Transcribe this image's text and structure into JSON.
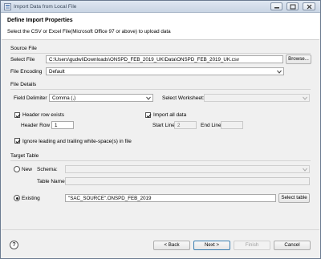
{
  "window": {
    "title": "Import Data from Local File"
  },
  "header": {
    "title": "Define Import Properties",
    "description": "Select the CSV or Excel File(Microsoft Office 97 or above) to upload data"
  },
  "source_file": {
    "group_label": "Source File",
    "file_label": "Select File",
    "file_value": "C:\\Users\\gudwi\\Downloads\\ONSPD_FEB_2019_UK\\Data\\ONSPD_FEB_2019_UK.csv",
    "browse_label": "Browse...",
    "encoding_label": "File Encoding",
    "encoding_value": "Default"
  },
  "file_details": {
    "group_label": "File Details",
    "delimiter_label": "Field Delimiter",
    "delimiter_value": "Comma (,)",
    "worksheet_label": "Select Worksheet:",
    "worksheet_value": "",
    "header_row_exists_label": "Header row exists",
    "header_row_exists_checked": true,
    "header_row_label": "Header Row :",
    "header_row_value": "1",
    "import_all_label": "Import all data",
    "import_all_checked": true,
    "start_line_label": "Start Line",
    "start_line_value": "2",
    "end_line_label": "End Line",
    "end_line_value": "",
    "ignore_whitespace_label": "Ignore leading and trailing white-space(s) in file",
    "ignore_whitespace_checked": true
  },
  "target_table": {
    "group_label": "Target Table",
    "new_label": "New",
    "new_selected": false,
    "schema_label": "Schema:",
    "schema_value": "",
    "table_name_label": "Table Name:",
    "table_name_value": "",
    "existing_label": "Existing",
    "existing_selected": true,
    "existing_value": "\"SAC_SOURCE\".ONSPD_FEB_2019",
    "select_table_label": "Select table"
  },
  "footer": {
    "help_glyph": "?",
    "back_label": "< Back",
    "next_label": "Next >",
    "finish_label": "Finish",
    "cancel_label": "Cancel"
  }
}
